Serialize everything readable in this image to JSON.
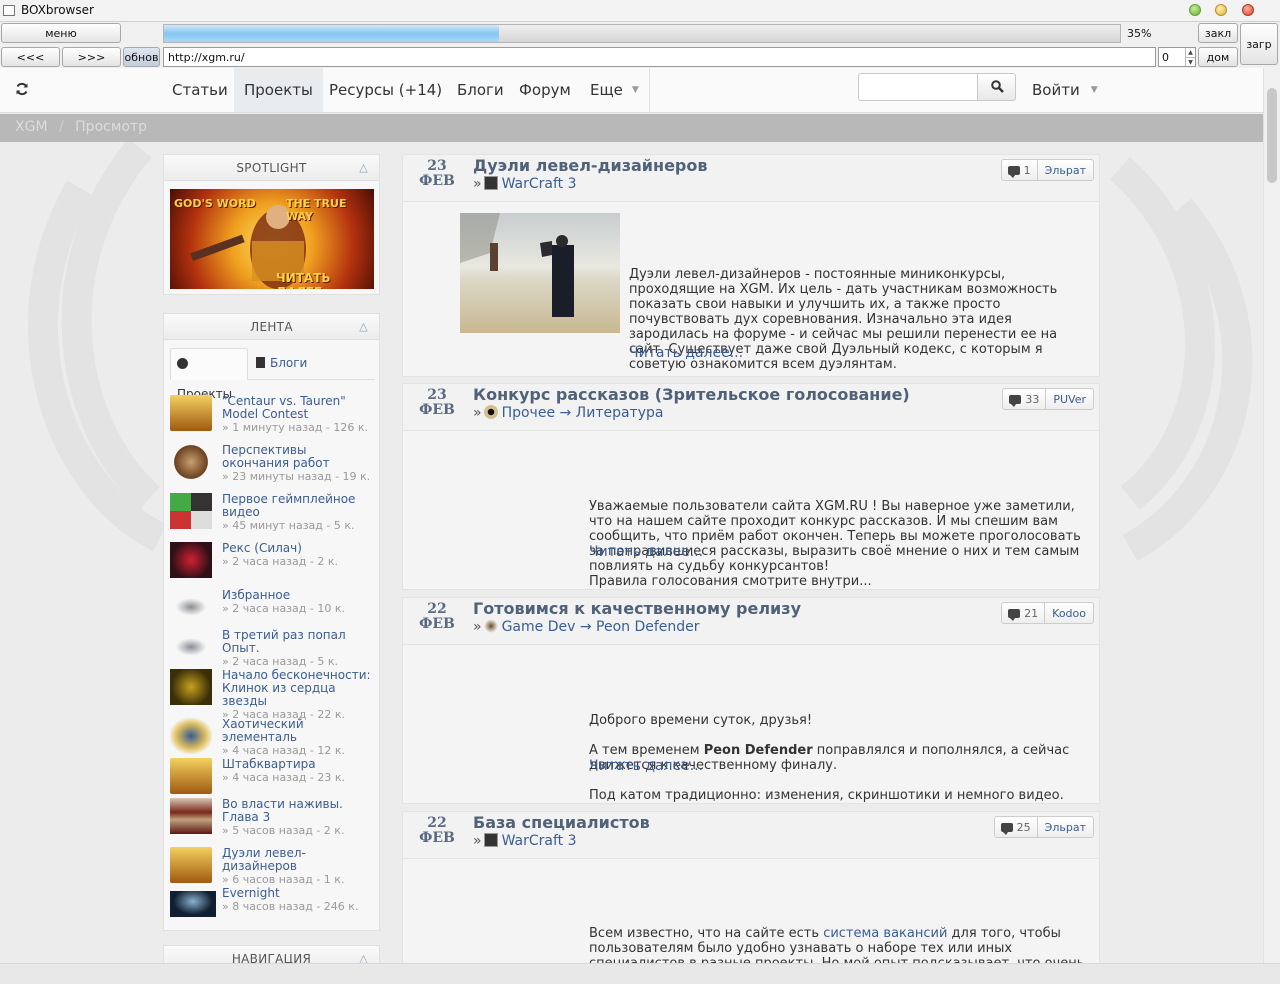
{
  "window": {
    "title": "BOXbrowser"
  },
  "toolbar": {
    "menu_label": "меню",
    "back_label": "<<<",
    "forward_label": ">>>",
    "refresh_label": "обнов",
    "progress_percent": 35,
    "progress_text": "35%",
    "url": "http://xgm.ru/",
    "spin_value": "0",
    "bookmark_label": "закл",
    "home_label": "дом",
    "downloads_label": "загр"
  },
  "nav": {
    "items": [
      "Статьи",
      "Проекты",
      "Ресурсы (+14)",
      "Блоги",
      "Форум",
      "Еще"
    ],
    "active": "Проекты",
    "login_label": "Войти",
    "search_placeholder": ""
  },
  "breadcrumb": {
    "root": "XGM",
    "sep": "/",
    "current": "Просмотр"
  },
  "sidebar": {
    "spotlight": {
      "title": "SPOTLIGHT",
      "banner_left": "GOD'S WORD",
      "banner_right": "THE TRUE WAY",
      "banner_cta": "ЧИТАТЬ ДАЛЕЕ"
    },
    "feed": {
      "title": "ЛЕНТА",
      "tabs": [
        "Проекты",
        "Блоги"
      ],
      "items": [
        {
          "title": "\"Centaur vs. Tauren\" Model Contest",
          "meta": "» 1 минуту назад - 126 к."
        },
        {
          "title": "Перспективы окончания работ",
          "meta": "» 23 минуты назад - 19 к."
        },
        {
          "title": "Первое геймплейное видео",
          "meta": "» 45 минут назад - 5 к."
        },
        {
          "title": "Рекс (Силач)",
          "meta": "» 2 часа назад - 2 к."
        },
        {
          "title": "Избранное",
          "meta": "» 2 часа назад - 10 к."
        },
        {
          "title": "В третий раз попал Опыт.",
          "meta": "» 2 часа назад - 5 к."
        },
        {
          "title": "Начало бесконечности: Клинок из сердца звезды",
          "meta": "» 2 часа назад - 22 к."
        },
        {
          "title": "Хаотический элементаль",
          "meta": "» 4 часа назад - 12 к."
        },
        {
          "title": "Штабквартира",
          "meta": "» 4 часа назад - 23 к."
        },
        {
          "title": "Во власти наживы. Глава 3",
          "meta": "» 5 часов назад - 2 к."
        },
        {
          "title": "Дуэли левел-дизайнеров",
          "meta": "» 6 часов назад - 1 к."
        },
        {
          "title": "Evernight",
          "meta": "» 8 часов назад - 246 к."
        }
      ]
    },
    "navigation": {
      "title": "НАВИГАЦИЯ"
    }
  },
  "posts": [
    {
      "day": "23",
      "month": "ФЕВ",
      "title": "Дуэли левел-дизайнеров",
      "category": "WarCraft 3",
      "comments": "1",
      "author": "Эльрат",
      "text": "Дуэли левел-дизайнеров - постоянные миниконкурсы, проходящие на XGM. Их цель - дать участникам возможность показать свои навыки и улучшить их, а также просто почувствовать дух соревнования. Изначально эта идея зародилась на форуме - и сейчас мы решили перенести ее на сайт. Существует даже свой Дуэльный кодекс, с которым я советую ознакомится всем дуэлянтам.",
      "readmore": "Читать далее..."
    },
    {
      "day": "23",
      "month": "ФЕВ",
      "title": "Конкурс рассказов (Зрительское голосование)",
      "category": "Прочее → Литература",
      "comments": "33",
      "author": "PUVer",
      "text": "Уважаемые пользователи сайта XGM.RU ! Вы наверное уже заметили, что на нашем сайте проходит конкурс рассказов. И мы спешим вам сообщить, что приём работ окончен. Теперь вы можете проголосовать за понравившиеся рассказы, выразить своё мнение о них и тем самым повлиять на судьбу конкурсантов!",
      "text2": "Правила голосования смотрите внутри...",
      "readmore": "Читать далее..."
    },
    {
      "day": "22",
      "month": "ФЕВ",
      "title": "Готовимся к качественному релизу",
      "category": "Game Dev → Peon Defender",
      "comments": "21",
      "author": "Kodoo",
      "text": "Доброго времени суток, друзья!",
      "text2a": "А тем временем ",
      "text2b": "Peon Defender",
      "text2c": " поправлялся и пополнялся, а сейчас движется к качественному финалу.",
      "text3": "Под катом традиционно: изменения, скриншотики и немного видео.",
      "readmore": "Читать далее..."
    },
    {
      "day": "22",
      "month": "ФЕВ",
      "title": "База специалистов",
      "category": "WarCraft 3",
      "comments": "25",
      "author": "Эльрат",
      "text_a": "Всем известно, что на сайте есть ",
      "text_link": "система вакансий",
      "text_b": " для того, чтобы пользователям было удобно узнавать о наборе тех или иных специалистов в разные проекты. Но мой опыт подсказывает, что очень часто в работе проекта набор участников происходит, в основном, за счет того, что сам руководитель пишет пользователю и предлагает ему поучаствовать в проекте. Поэтому мы создаем данную тему, чтобы"
    }
  ],
  "colors": {
    "accent": "#3a5d93",
    "progress": "#87c6f0",
    "breadcrumb_bg": "#b8b8b8"
  }
}
